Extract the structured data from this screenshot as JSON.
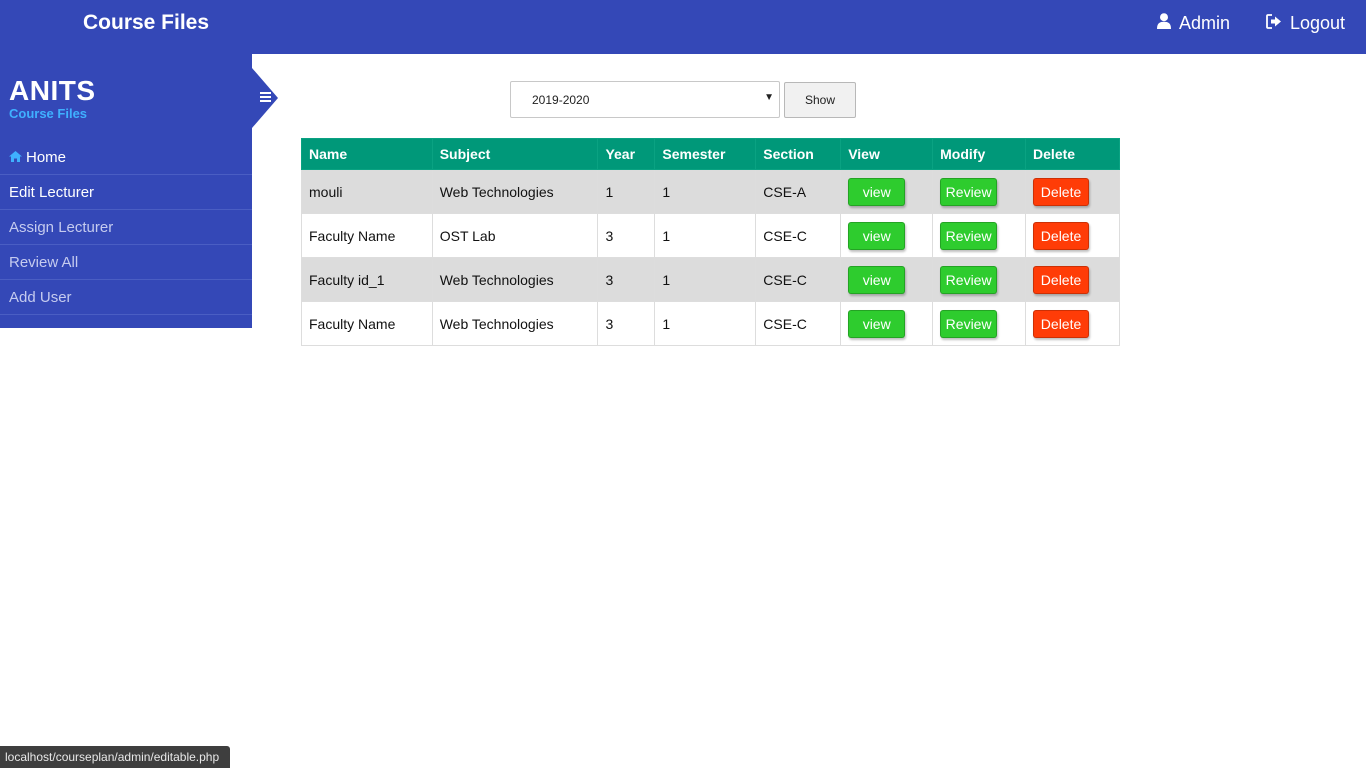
{
  "header": {
    "title": "Course Files",
    "admin_label": "Admin",
    "logout_label": "Logout"
  },
  "sidebar": {
    "title": "ANITS",
    "subtitle": "Course Files",
    "items": [
      {
        "label": "Home",
        "icon": "home-icon"
      },
      {
        "label": "Edit Lecturer"
      },
      {
        "label": "Assign Lecturer"
      },
      {
        "label": "Review All"
      },
      {
        "label": "Add User"
      }
    ]
  },
  "filter": {
    "year_value": "2019-2020",
    "show_label": "Show"
  },
  "table": {
    "headers": [
      "Name",
      "Subject",
      "Year",
      "Semester",
      "Section",
      "View",
      "Modify",
      "Delete"
    ],
    "rows": [
      {
        "name": "mouli",
        "subject": "Web Technologies",
        "year": "1",
        "semester": "1",
        "section": "CSE-A",
        "view": "view",
        "modify": "Review",
        "delete": "Delete"
      },
      {
        "name": "Faculty Name",
        "subject": "OST Lab",
        "year": "3",
        "semester": "1",
        "section": "CSE-C",
        "view": "view",
        "modify": "Review",
        "delete": "Delete"
      },
      {
        "name": "Faculty id_1",
        "subject": "Web Technologies",
        "year": "3",
        "semester": "1",
        "section": "CSE-C",
        "view": "view",
        "modify": "Review",
        "delete": "Delete"
      },
      {
        "name": "Faculty Name",
        "subject": "Web Technologies",
        "year": "3",
        "semester": "1",
        "section": "CSE-C",
        "view": "view",
        "modify": "Review",
        "delete": "Delete"
      }
    ]
  },
  "status_url": "localhost/courseplan/admin/editable.php",
  "colors": {
    "primary": "#3448b7",
    "table_header": "#009879",
    "button_green": "#2ecc2e",
    "button_red": "#ff3c07",
    "accent_blue": "#3fb0ff"
  }
}
